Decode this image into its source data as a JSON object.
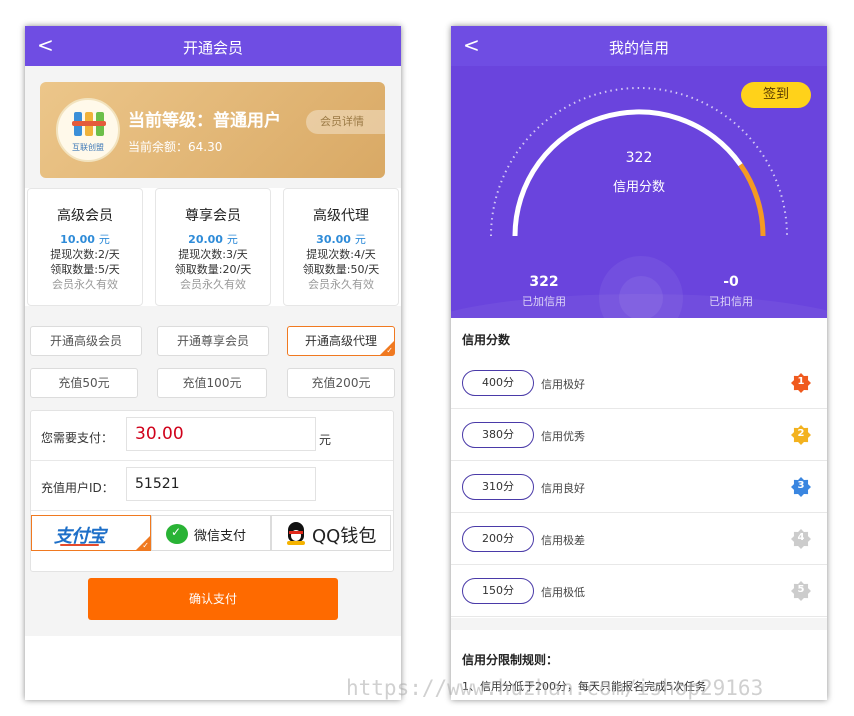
{
  "left": {
    "nav": {
      "back": "<",
      "title": "开通会员"
    },
    "card": {
      "brand": "互联创盟",
      "level_prefix": "当前等级：",
      "level_name": "普通用户",
      "balance_label": "当前余额：",
      "balance_value": "64.30",
      "detail_button": "会员详情"
    },
    "plans": [
      {
        "name": "高级会员",
        "price": "10.00",
        "unit": "元",
        "withdraw": "提现次数:2/天",
        "claim": "领取数量:5/天",
        "valid": "会员永久有效"
      },
      {
        "name": "尊享会员",
        "price": "20.00",
        "unit": "元",
        "withdraw": "提现次数:3/天",
        "claim": "领取数量:20/天",
        "valid": "会员永久有效"
      },
      {
        "name": "高级代理",
        "price": "30.00",
        "unit": "元",
        "withdraw": "提现次数:4/天",
        "claim": "领取数量:50/天",
        "valid": "会员永久有效"
      }
    ],
    "open_options": [
      "开通高级会员",
      "开通尊享会员",
      "开通高级代理"
    ],
    "selected_open_option": 2,
    "recharge_options": [
      "充值50元",
      "充值100元",
      "充值200元"
    ],
    "payment": {
      "amount_label": "您需要支付：",
      "amount_value": "30.00",
      "amount_unit": "元",
      "user_id_label": "充值用户ID：",
      "user_id_value": "51521"
    },
    "methods": {
      "alipay": "支付宝",
      "wechat": "微信支付",
      "qq": "QQ钱包",
      "selected": "alipay"
    },
    "confirm_button": "确认支付"
  },
  "right": {
    "nav": {
      "back": "<",
      "title": "我的信用"
    },
    "sign_button": "签到",
    "score": "322",
    "score_label": "信用分数",
    "gauge": {
      "min": 0,
      "max": 400,
      "value": 322
    },
    "added": {
      "value": "322",
      "label": "已加信用"
    },
    "deducted": {
      "value": "-0",
      "label": "已扣信用"
    },
    "levels_title": "信用分数",
    "levels": [
      {
        "score": "400分",
        "desc": "信用极好",
        "rank": "1",
        "color": "#f05a1e"
      },
      {
        "score": "380分",
        "desc": "信用优秀",
        "rank": "2",
        "color": "#f3b21f"
      },
      {
        "score": "310分",
        "desc": "信用良好",
        "rank": "3",
        "color": "#3a86e0"
      },
      {
        "score": "200分",
        "desc": "信用极差",
        "rank": "4",
        "color": "#cccccc"
      },
      {
        "score": "150分",
        "desc": "信用极低",
        "rank": "5",
        "color": "#cccccc"
      }
    ],
    "rules_title": "信用分限制规则：",
    "rules": [
      "1、信用分低于200分，每天只能报名完成5次任务"
    ]
  },
  "colors": {
    "brand_purple": "#6f4de3",
    "orange": "#fe6a00",
    "price_blue": "#2e8bd8",
    "gauge_orange": "#f59a23"
  },
  "watermark": "https://www.huzhan.com/ishop29163"
}
